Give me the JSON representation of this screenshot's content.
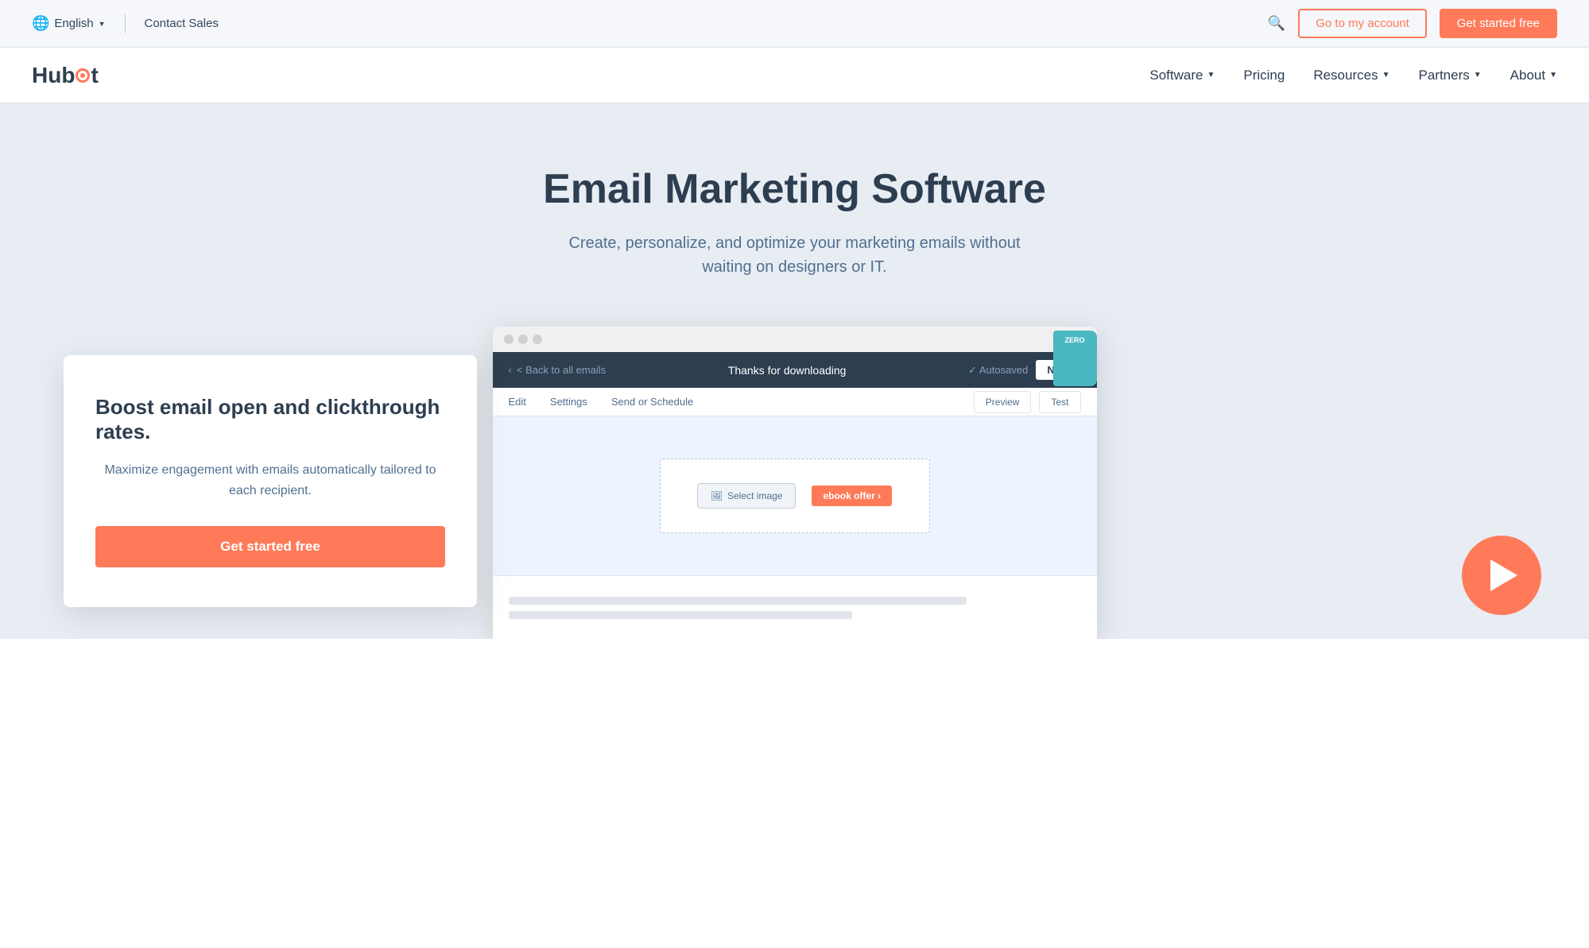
{
  "topbar": {
    "lang_label": "English",
    "contact_sales_label": "Contact Sales",
    "go_to_account_label": "Go to my account",
    "get_started_label": "Get started free"
  },
  "nav": {
    "logo_hub": "Hub",
    "logo_spot": "Sp",
    "logo_ot": "t",
    "software_label": "Software",
    "pricing_label": "Pricing",
    "resources_label": "Resources",
    "partners_label": "Partners",
    "about_label": "About"
  },
  "hero": {
    "title": "Email Marketing Software",
    "subtitle": "Create, personalize, and optimize your marketing emails without waiting on designers or IT."
  },
  "browser": {
    "back_label": "< Back to all emails",
    "email_subject": "Thanks for downloading",
    "autosaved_label": "✓ Autosaved",
    "next_label": "Next",
    "tab_edit": "Edit",
    "tab_settings": "Settings",
    "tab_send": "Send or Schedule",
    "preview_label": "Preview",
    "test_label": "Test",
    "select_image_label": "Select image",
    "ebook_label": "ZERO",
    "ebook_cta_label": "ebook offer ›"
  },
  "card": {
    "title": "Boost email open and clickthrough rates.",
    "text": "Maximize engagement with emails automatically tailored to each recipient.",
    "cta_label": "Get started free"
  },
  "icons": {
    "globe": "🌐",
    "chevron_down": "▼",
    "search": "🔍"
  }
}
